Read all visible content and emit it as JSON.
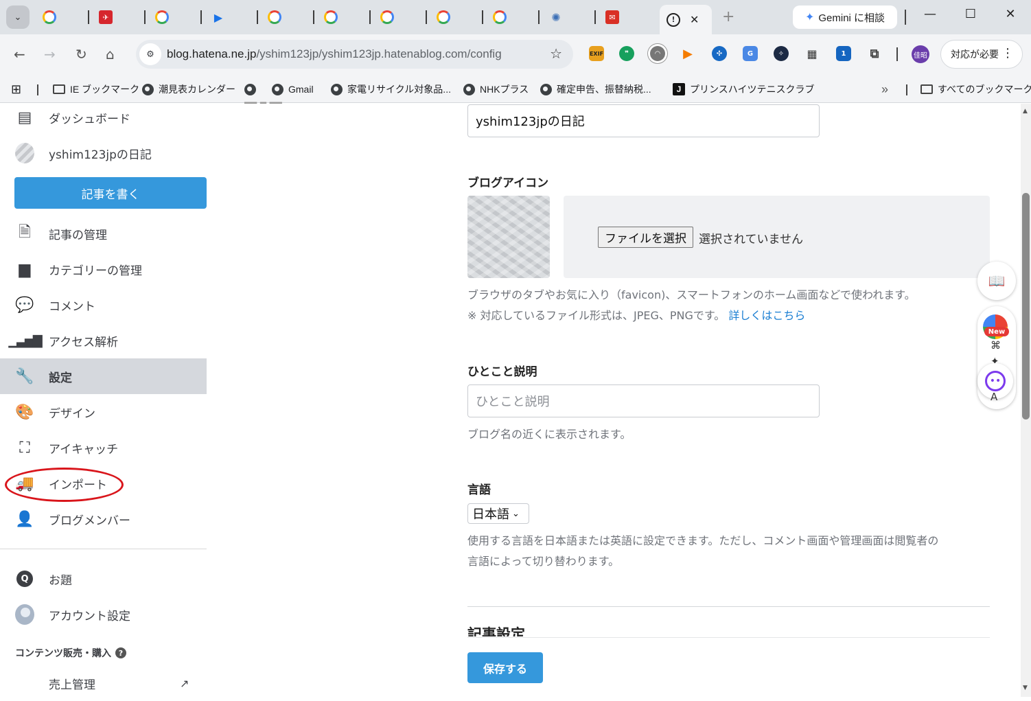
{
  "browser": {
    "active_tab_close": "✕",
    "new_tab": "+",
    "gemini_button": "Gemini に相談",
    "window_controls": [
      "—",
      "☐",
      "✕"
    ],
    "url_host": "blog.hatena.ne.jp",
    "url_path": "/yshim123jp/yshim123jp.hatenablog.com/config",
    "ext_exif": "EXIF",
    "profile": "佳昭",
    "action_button": "対応が必要",
    "bookmarks": [
      "IE ブックマーク",
      "潮見表カレンダー",
      "Gmail",
      "家電リサイクル対象品...",
      "NHKプラス",
      "確定申告、振替納税...",
      "プリンスハイツテニスクラブ"
    ],
    "all_bookmarks": "すべてのブックマーク",
    "bookmark_overflow": "»",
    "tab_icon_J": "J"
  },
  "sidebar": {
    "dashboard": "ダッシュボード",
    "blog_name": "yshim123jpの日記",
    "write_button": "記事を書く",
    "items": [
      "記事の管理",
      "カテゴリーの管理",
      "コメント",
      "アクセス解析",
      "設定",
      "デザイン",
      "アイキャッチ",
      "インポート",
      "ブログメンバー"
    ],
    "active_item": "設定",
    "odai": "お題",
    "account": "アカウント設定",
    "section_heading": "コンテンツ販売・購入",
    "help_icon": "?",
    "sales": "売上管理",
    "odai_icon": "Q"
  },
  "main": {
    "blog_title_value": "yshim123jpの日記",
    "blog_icon_label": "ブログアイコン",
    "file_button": "ファイルを選択",
    "file_status": "選択されていません",
    "icon_note_1": "ブラウザのタブやお気に入り（favicon)、スマートフォンのホーム画面などで使われます。",
    "icon_note_2": "※ 対応しているファイル形式は、JPEG、PNGです。",
    "icon_note_link": "詳しくはこちら",
    "description_label": "ひとこと説明",
    "description_placeholder": "ひとこと説明",
    "description_note": "ブログ名の近くに表示されます。",
    "language_label": "言語",
    "language_value": "日本語",
    "language_note_1": "使用する言語を日本語または英語に設定できます。ただし、コメント画面や管理画面は閲覧者の",
    "language_note_2": "言語によって切り替わります。",
    "article_settings_title": "記事設定",
    "save_button": "保存する"
  },
  "widgets": {
    "new_badge": "New"
  },
  "colors": {
    "accent": "#3598dc",
    "active_sidebar_bg": "#d5d8dd",
    "highlight_oval": "#d9151b",
    "link": "#1a7ed2"
  }
}
